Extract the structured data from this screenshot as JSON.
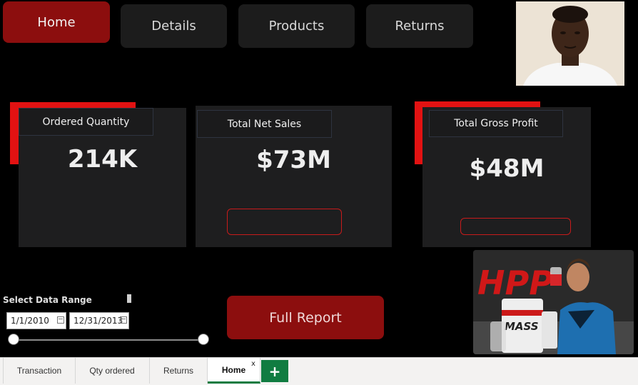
{
  "nav": {
    "items": [
      {
        "label": "Home",
        "active": true
      },
      {
        "label": "Details"
      },
      {
        "label": "Products"
      },
      {
        "label": "Returns"
      }
    ]
  },
  "kpis": [
    {
      "title": "Ordered Quantity",
      "value": "214K"
    },
    {
      "title": "Total Net Sales",
      "value": "$73M"
    },
    {
      "title": "Total Gross Profit",
      "value": "$48M"
    }
  ],
  "slicer": {
    "title": "Select Data Range",
    "start": "1/1/2010",
    "end": "12/31/2013"
  },
  "buttons": {
    "full_report": "Full Report"
  },
  "promo": {
    "brand": "HPP",
    "product": "MASS"
  },
  "tabs": {
    "items": [
      "Transaction",
      "Qty ordered",
      "Returns",
      "Home"
    ],
    "active": "Home",
    "close": "x",
    "add": "+"
  },
  "colors": {
    "accent": "#e21212",
    "button": "#8c0e0e",
    "tab_accent": "#107c41"
  }
}
